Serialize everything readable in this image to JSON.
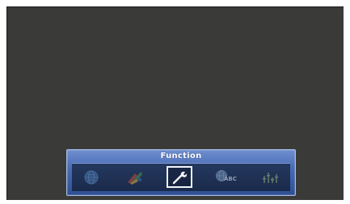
{
  "osd": {
    "title": "Function",
    "selected_index": 2,
    "items": [
      {
        "icon": "globe-icon"
      },
      {
        "icon": "picture-adjust-icon"
      },
      {
        "icon": "wrench-icon"
      },
      {
        "icon": "language-abc-icon",
        "text": "ABC"
      },
      {
        "icon": "audio-equalizer-icon"
      }
    ]
  },
  "colors": {
    "screen_background": "#3a3a38",
    "panel_light": "#6f8fd0",
    "panel_dark": "#2e4f93",
    "selection_border": "#f2f4f8"
  }
}
